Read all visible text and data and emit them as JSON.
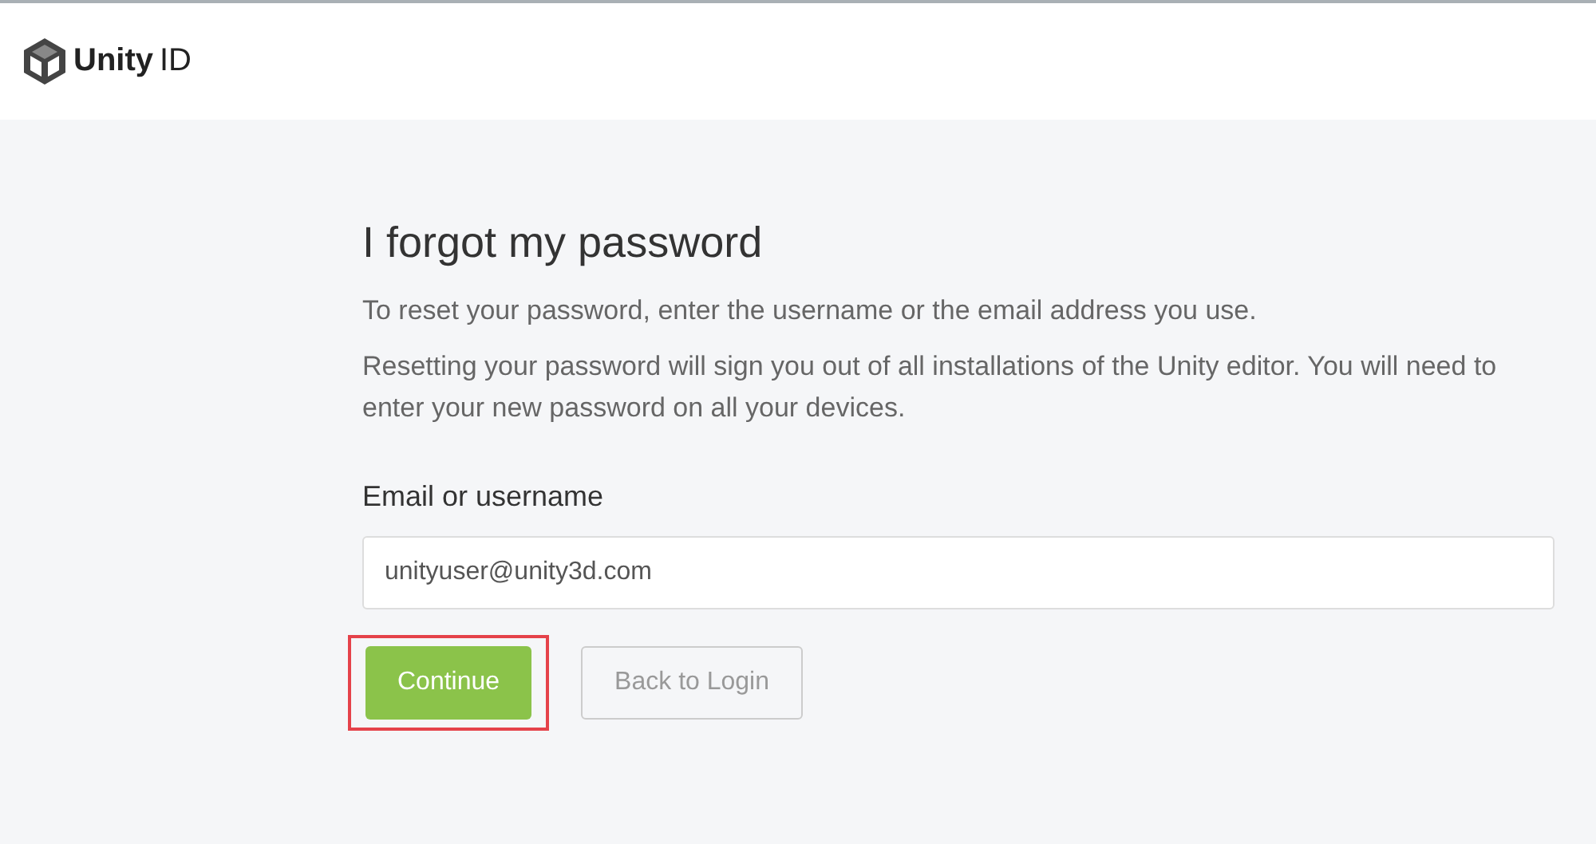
{
  "header": {
    "logo_brand": "Unity",
    "logo_product": "ID"
  },
  "title": "I forgot my password",
  "paragraphs": [
    "To reset your password, enter the username or the email address you use.",
    "Resetting your password will sign you out of all installations of the Unity editor. You will need to enter your new password on all your devices."
  ],
  "field": {
    "label": "Email or username",
    "value": "unityuser@unity3d.com"
  },
  "buttons": [
    {
      "label": "Continue",
      "kind": "primary",
      "highlighted": true
    },
    {
      "label": "Back to Login",
      "kind": "secondary",
      "highlighted": false
    }
  ]
}
